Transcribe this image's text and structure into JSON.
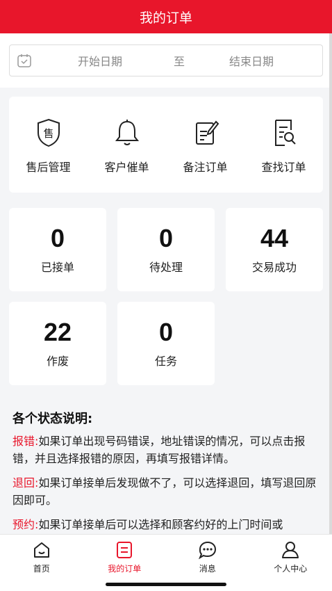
{
  "header": {
    "title": "我的订单"
  },
  "date_filter": {
    "start_placeholder": "开始日期",
    "separator": "至",
    "end_placeholder": "结束日期"
  },
  "tools": [
    {
      "label": "售后管理",
      "icon": "after-sales-shield-icon"
    },
    {
      "label": "客户催单",
      "icon": "bell-icon"
    },
    {
      "label": "备注订单",
      "icon": "edit-note-icon"
    },
    {
      "label": "查找订单",
      "icon": "search-document-icon"
    }
  ],
  "stats": [
    {
      "value": "0",
      "label": "已接单"
    },
    {
      "value": "0",
      "label": "待处理"
    },
    {
      "value": "44",
      "label": "交易成功"
    },
    {
      "value": "22",
      "label": "作废"
    },
    {
      "value": "0",
      "label": "任务"
    }
  ],
  "tools_shield_char": "售",
  "status_desc": {
    "title": "各个状态说明:",
    "items": [
      {
        "key": "报错:",
        "text": "如果订单出现号码错误，地址错误的情况，可以点击报错，并且选择报错的原因，再填写报错详情。"
      },
      {
        "key": "退回:",
        "text": "如果订单接单后发现做不了，可以选择退回，填写退回原因即可。"
      },
      {
        "key": "预约:",
        "text": "如果订单接单后可以选择和顾客约好的上门时间或"
      }
    ]
  },
  "tabbar": [
    {
      "label": "首页",
      "icon": "home-icon"
    },
    {
      "label": "我的订单",
      "icon": "order-list-icon"
    },
    {
      "label": "消息",
      "icon": "message-icon"
    },
    {
      "label": "个人中心",
      "icon": "user-icon"
    }
  ],
  "colors": {
    "brand": "#e8162b",
    "background": "#f4f5f7"
  }
}
